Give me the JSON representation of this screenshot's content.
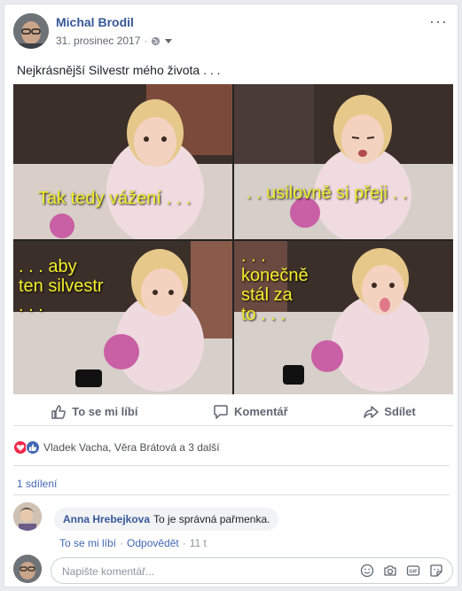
{
  "post": {
    "author": "Michal Brodil",
    "date": "31. prosinec 2017",
    "meta_dot": "·",
    "more": "···",
    "text": "Nejkrásnější Silvestr mého života . . ."
  },
  "photo": {
    "captions": [
      "Tak tedy vážení . . .",
      ". . usilovně si přeji . .",
      ". . . aby\nten silvestr\n. . .",
      ". . .\nkonečně\nstál za\nto . . ."
    ]
  },
  "actions": {
    "like": "To se mi líbí",
    "comment": "Komentář",
    "share": "Sdílet"
  },
  "reactions": {
    "names": "Vladek Vacha, Věra Brátová a 3 další"
  },
  "shares": {
    "label": "1 sdílení"
  },
  "comment": {
    "author": "Anna Hrebejkova",
    "text": "To je správná pařmenka.",
    "like": "To se mi líbí",
    "sep": "·",
    "reply": "Odpovědět",
    "time": "11 t"
  },
  "reply_box": {
    "placeholder": "Napište komentář..."
  },
  "colors": {
    "link": "#385898",
    "like_blue": "#4267b2",
    "love_red": "#f0284a",
    "caption_yellow": "#f4ef2a"
  }
}
